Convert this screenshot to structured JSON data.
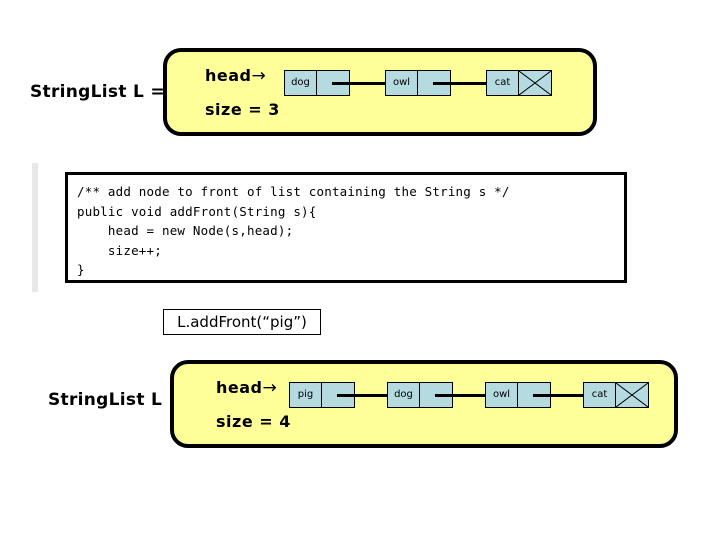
{
  "slide": {
    "background_color": "#ffffff",
    "panel_color": "#ffff99",
    "node_color": "#b5dae0",
    "sidebar_color": "#e8e8e8"
  },
  "before": {
    "variable_label": "StringList L =",
    "head_field": "head",
    "head_arrow": "→",
    "size_field": "size = 3",
    "nodes": [
      {
        "value": "dog",
        "next": "arrow"
      },
      {
        "value": "owl",
        "next": "arrow"
      },
      {
        "value": "cat",
        "next": "null"
      }
    ]
  },
  "code": {
    "comment": "/** add node to front of list containing the String s */",
    "line_signature": "public void addFront(String s){",
    "line_head": "    head = new Node(s,head);",
    "line_size": "    size++;",
    "line_close": "}",
    "full_text": "/** add node to front of list containing the String s */\npublic void addFront(String s){\n    head = new Node(s,head);\n    size++;\n}"
  },
  "call": {
    "label": "L.addFront(“pig”)"
  },
  "after": {
    "variable_label": "StringList L =",
    "head_field": "head",
    "head_arrow": "→",
    "size_field": "size = 4",
    "nodes": [
      {
        "value": "pig",
        "next": "arrow"
      },
      {
        "value": "dog",
        "next": "arrow"
      },
      {
        "value": "owl",
        "next": "arrow"
      },
      {
        "value": "cat",
        "next": "null"
      }
    ]
  }
}
